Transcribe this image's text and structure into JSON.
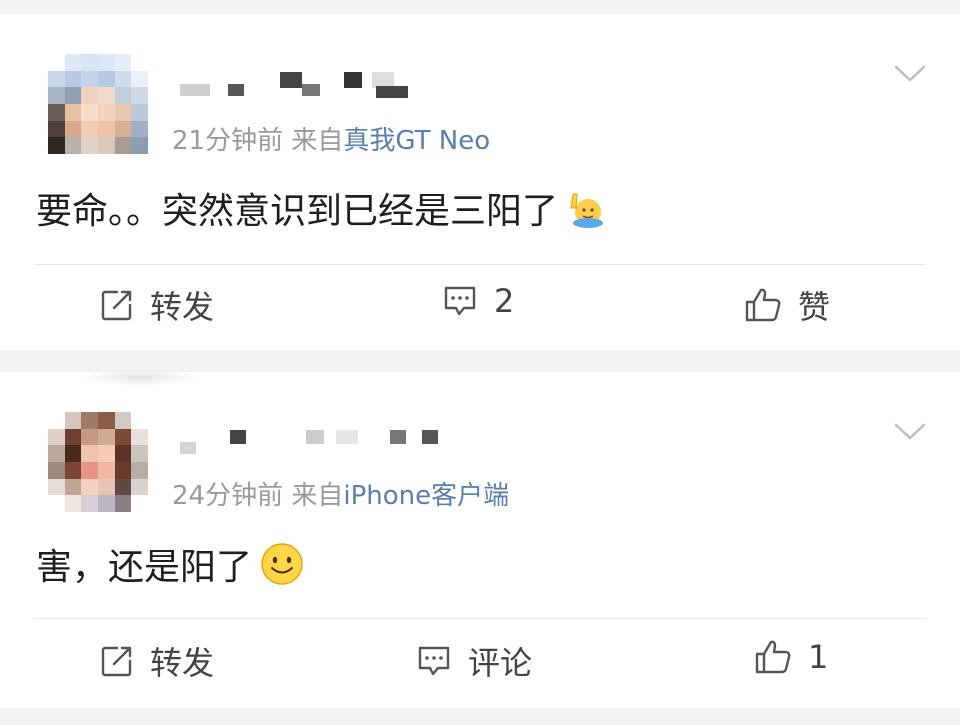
{
  "posts": [
    {
      "time": "21分钟前",
      "source_prefix": "来自",
      "source": "真我GT Neo",
      "text": "要命。。突然意识到已经是三阳了",
      "emoji": "raising-hand-emoji",
      "actions": {
        "repost": "转发",
        "comment": "2",
        "like": "赞"
      }
    },
    {
      "time": "24分钟前",
      "source_prefix": "来自",
      "source": "iPhone客户端",
      "text": "害，还是阳了",
      "emoji": "smile-emoji",
      "actions": {
        "repost": "转发",
        "comment": "评论",
        "like": "1"
      }
    }
  ],
  "colors": {
    "source_link": "#5b7fad",
    "meta": "#9a9a9a",
    "background": "#f2f2f2"
  }
}
